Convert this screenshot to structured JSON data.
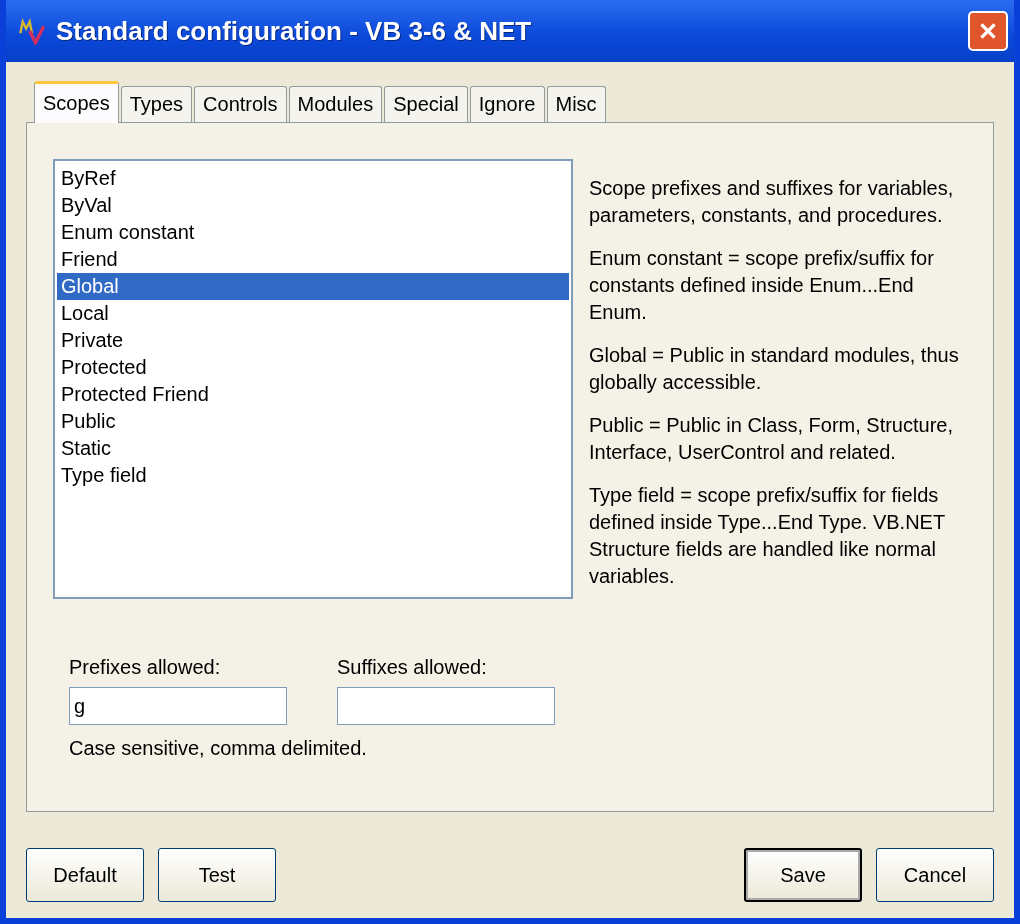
{
  "window": {
    "title": "Standard configuration - VB 3-6 & NET"
  },
  "tabs": [
    {
      "label": "Scopes",
      "selected": true
    },
    {
      "label": "Types",
      "selected": false
    },
    {
      "label": "Controls",
      "selected": false
    },
    {
      "label": "Modules",
      "selected": false
    },
    {
      "label": "Special",
      "selected": false
    },
    {
      "label": "Ignore",
      "selected": false
    },
    {
      "label": "Misc",
      "selected": false
    }
  ],
  "scope_list": [
    {
      "label": "ByRef",
      "selected": false
    },
    {
      "label": "ByVal",
      "selected": false
    },
    {
      "label": "Enum constant",
      "selected": false
    },
    {
      "label": "Friend",
      "selected": false
    },
    {
      "label": "Global",
      "selected": true
    },
    {
      "label": "Local",
      "selected": false
    },
    {
      "label": "Private",
      "selected": false
    },
    {
      "label": "Protected",
      "selected": false
    },
    {
      "label": "Protected Friend",
      "selected": false
    },
    {
      "label": "Public",
      "selected": false
    },
    {
      "label": "Static",
      "selected": false
    },
    {
      "label": "Type field",
      "selected": false
    }
  ],
  "description": [
    "Scope prefixes and suffixes for variables, parameters, constants, and procedures.",
    "Enum constant = scope prefix/suffix for constants defined inside Enum...End Enum.",
    "Global = Public in standard modules, thus globally accessible.",
    "Public = Public in Class, Form, Structure, Interface, UserControl and related.",
    "Type field = scope prefix/suffix for fields defined inside Type...End Type. VB.NET Structure fields are handled like normal variables."
  ],
  "prefixes": {
    "label": "Prefixes allowed:",
    "value": "g"
  },
  "suffixes": {
    "label": "Suffixes allowed:"
  },
  "hint": "Case sensitive, comma delimited.",
  "buttons_left": [
    "Default",
    "Test"
  ],
  "buttons_right": [
    {
      "label": "Save",
      "default": true
    },
    {
      "label": "Cancel",
      "default": false
    }
  ]
}
